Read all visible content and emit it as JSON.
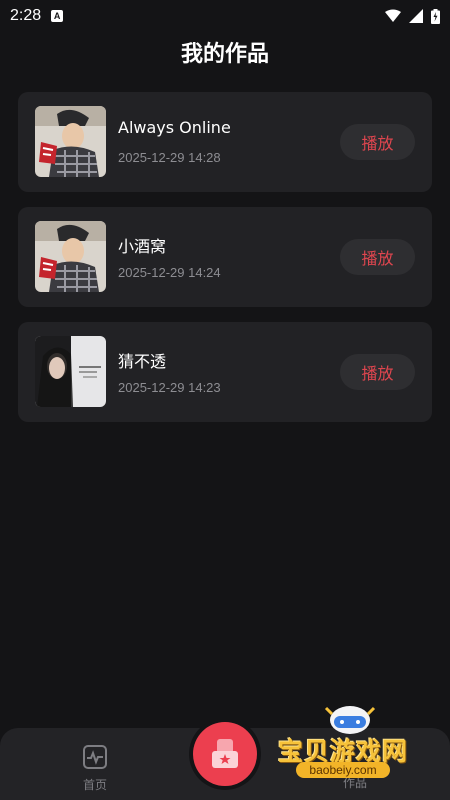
{
  "status_bar": {
    "time": "2:28",
    "notification_icon": "a-icon"
  },
  "page": {
    "title": "我的作品"
  },
  "works": [
    {
      "title": "Always Online",
      "date": "2025-12-29 14:28",
      "play_label": "播放",
      "cover_icon": "album-cover-1"
    },
    {
      "title": "小酒窝",
      "date": "2025-12-29 14:24",
      "play_label": "播放",
      "cover_icon": "album-cover-2"
    },
    {
      "title": "猜不透",
      "date": "2025-12-29 14:23",
      "play_label": "播放",
      "cover_icon": "album-cover-3"
    }
  ],
  "tabbar": {
    "home_label": "首页",
    "works_label": "作品"
  },
  "watermark": {
    "text": "宝贝游戏网",
    "url": "baobeiy.com"
  },
  "colors": {
    "background": "#141416",
    "card": "#222225",
    "accent": "#ec3f4f",
    "play_text": "#e0464f"
  }
}
